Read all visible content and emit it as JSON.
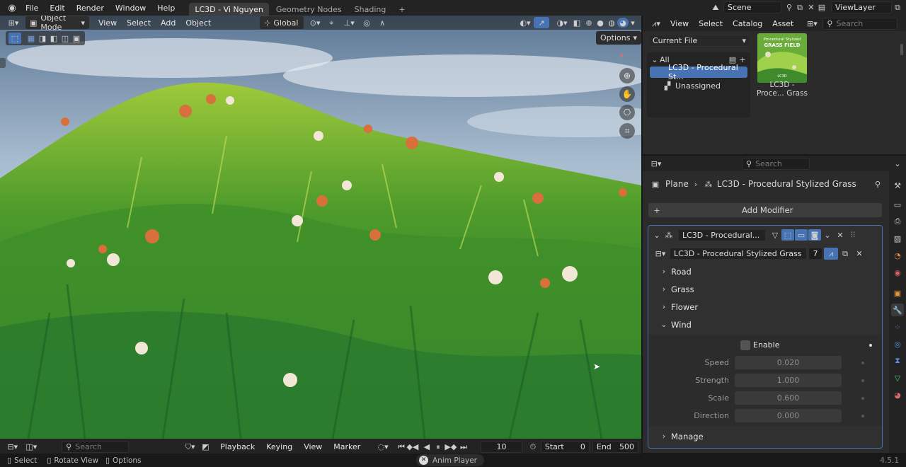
{
  "menu": {
    "items": [
      "File",
      "Edit",
      "Render",
      "Window",
      "Help"
    ]
  },
  "workspaces": {
    "tabs": [
      {
        "label": "LC3D - Vi Nguyen",
        "active": true
      },
      {
        "label": "Geometry Nodes",
        "active": false
      },
      {
        "label": "Shading",
        "active": false
      }
    ],
    "add": "+"
  },
  "scene": {
    "label": "Scene",
    "view_layer": "ViewLayer"
  },
  "viewport": {
    "mode": "Object Mode",
    "menus": [
      "View",
      "Select",
      "Add",
      "Object"
    ],
    "orientation": "Global",
    "options": "Options"
  },
  "timeline": {
    "search_placeholder": "Search",
    "menus": [
      "Playback",
      "Keying",
      "View",
      "Marker"
    ],
    "current_frame": "10",
    "start_label": "Start",
    "start": "0",
    "end_label": "End",
    "end": "500"
  },
  "status": {
    "select": "Select",
    "rotate": "Rotate View",
    "options": "Options",
    "anim_player": "Anim Player",
    "version": "4.5.1"
  },
  "asset_browser": {
    "menus": [
      "View",
      "Select",
      "Catalog",
      "Asset"
    ],
    "search_placeholder": "Search",
    "library": "Current File",
    "tree": {
      "all": "All",
      "selected": "LC3D - Procedural St...",
      "unassigned": "Unassigned"
    },
    "asset": {
      "name_line1": "LC3D -",
      "name_line2": "Proce... Grass",
      "thumb_line1": "Procedural Stylized",
      "thumb_line2": "GRASS FIELD",
      "thumb_tag": "LC3D"
    }
  },
  "properties": {
    "search_placeholder": "Search",
    "breadcrumb": {
      "object": "Plane",
      "modifier": "LC3D - Procedural Stylized Grass"
    },
    "add_modifier": "Add Modifier",
    "modifier": {
      "name": "LC3D - Procedural...",
      "node_group": "LC3D - Procedural Stylized Grass",
      "users": "7"
    },
    "panels": [
      "Road",
      "Grass",
      "Flower"
    ],
    "wind": {
      "label": "Wind",
      "enable": "Enable",
      "fields": [
        {
          "label": "Speed",
          "value": "0.020"
        },
        {
          "label": "Strength",
          "value": "1.000"
        },
        {
          "label": "Scale",
          "value": "0.600"
        },
        {
          "label": "Direction",
          "value": "0.000"
        }
      ]
    },
    "manage": "Manage"
  },
  "colors": {
    "accent": "#4772b3",
    "active_tab": "#3d3d3d",
    "panel": "#2b2b2b",
    "header": "#232323"
  }
}
